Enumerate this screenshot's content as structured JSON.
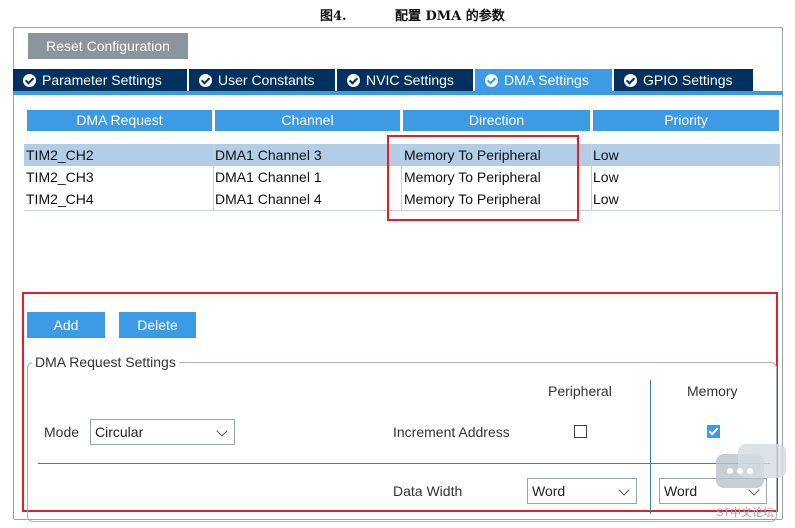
{
  "caption": {
    "figure": "图4.",
    "title": "配置 DMA 的参数"
  },
  "toolbar": {
    "reset_label": "Reset Configuration"
  },
  "tabs": [
    {
      "label": "Parameter Settings",
      "active": false
    },
    {
      "label": "User Constants",
      "active": false
    },
    {
      "label": "NVIC Settings",
      "active": false
    },
    {
      "label": "DMA Settings",
      "active": true
    },
    {
      "label": "GPIO Settings",
      "active": false
    }
  ],
  "table": {
    "headers": [
      "DMA Request",
      "Channel",
      "Direction",
      "Priority"
    ],
    "rows": [
      {
        "request": "TIM2_CH2",
        "channel": "DMA1 Channel 3",
        "direction": "Memory To Peripheral",
        "priority": "Low",
        "selected": true
      },
      {
        "request": "TIM2_CH3",
        "channel": "DMA1 Channel 1",
        "direction": "Memory To Peripheral",
        "priority": "Low",
        "selected": false
      },
      {
        "request": "TIM2_CH4",
        "channel": "DMA1 Channel 4",
        "direction": "Memory To Peripheral",
        "priority": "Low",
        "selected": false
      }
    ]
  },
  "actions": {
    "add_label": "Add",
    "delete_label": "Delete"
  },
  "settings": {
    "legend": "DMA Request Settings",
    "mode_label": "Mode",
    "mode_value": "Circular",
    "col_peripheral": "Peripheral",
    "col_memory": "Memory",
    "increment_label": "Increment Address",
    "increment_peripheral": false,
    "increment_memory": true,
    "data_width_label": "Data Width",
    "data_width_peripheral": "Word",
    "data_width_memory": "Word"
  },
  "watermark": "ST中文论坛",
  "colors": {
    "accent": "#3c9be4",
    "tab_dark": "#00315f",
    "highlight_box": "#e0202a",
    "selected_row": "#b3cde6"
  }
}
